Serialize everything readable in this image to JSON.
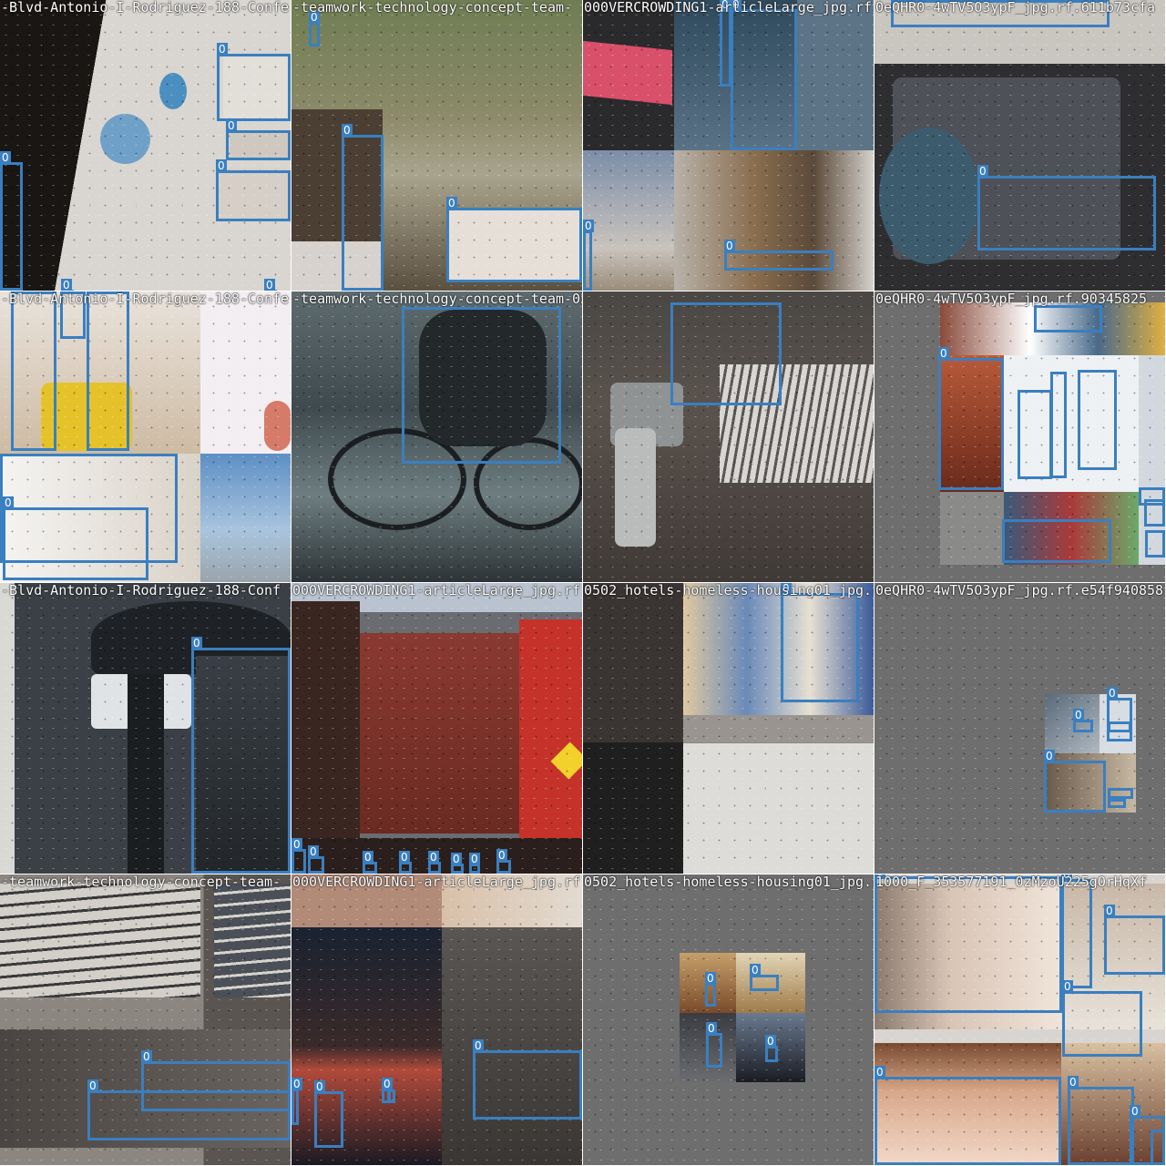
{
  "mosaic": {
    "box_color": "#3a7fc0",
    "label_class": "0",
    "tiles": [
      {
        "caption": "-Blvd-Antonio-I-Rodriguez-188-Confe",
        "box_count": 6
      },
      {
        "caption": "-teamwork-technology-concept-team-",
        "box_count": 3
      },
      {
        "caption": "000VERCROWDING1-articleLarge_jpg.rf.d",
        "box_count": 4
      },
      {
        "caption": "0eQHR0-4wTV5O3ypF_jpg.rf.611b73cfa",
        "box_count": 1
      },
      {
        "caption": "-Blvd-Antonio-I-Rodriguez-188-Confe",
        "box_count": 5
      },
      {
        "caption": "-teamwork-technology-concept-team-0502_hotels-homeless-housing01_jpg",
        "box_count": 1
      },
      {
        "caption": "",
        "box_count": 1
      },
      {
        "caption": "0eQHR0-4wTV5O3ypF_jpg.rf.90345825",
        "box_count": 9
      },
      {
        "caption": "-Blvd-Antonio-I-Rodriguez-188-Conf",
        "box_count": 1
      },
      {
        "caption": "000VERCROWDING1-articleLarge_jpg.rf.2",
        "box_count": 8
      },
      {
        "caption": "0502_hotels-homeless-housing01_jpg.rf",
        "box_count": 1
      },
      {
        "caption": "0eQHR0-4wTV5O3ypF_jpg.rf.e54f940858",
        "box_count": 6
      },
      {
        "caption": "-teamwork-technology-concept-team-",
        "box_count": 2
      },
      {
        "caption": "000VERCROWDING1-articleLarge_jpg.rf.7",
        "box_count": 5
      },
      {
        "caption": "0502_hotels-homeless-housing01_jpg.r",
        "box_count": 3
      },
      {
        "caption": "1000_F_353577191_0zMzoU225gOrHqXf",
        "box_count": 8
      }
    ]
  }
}
